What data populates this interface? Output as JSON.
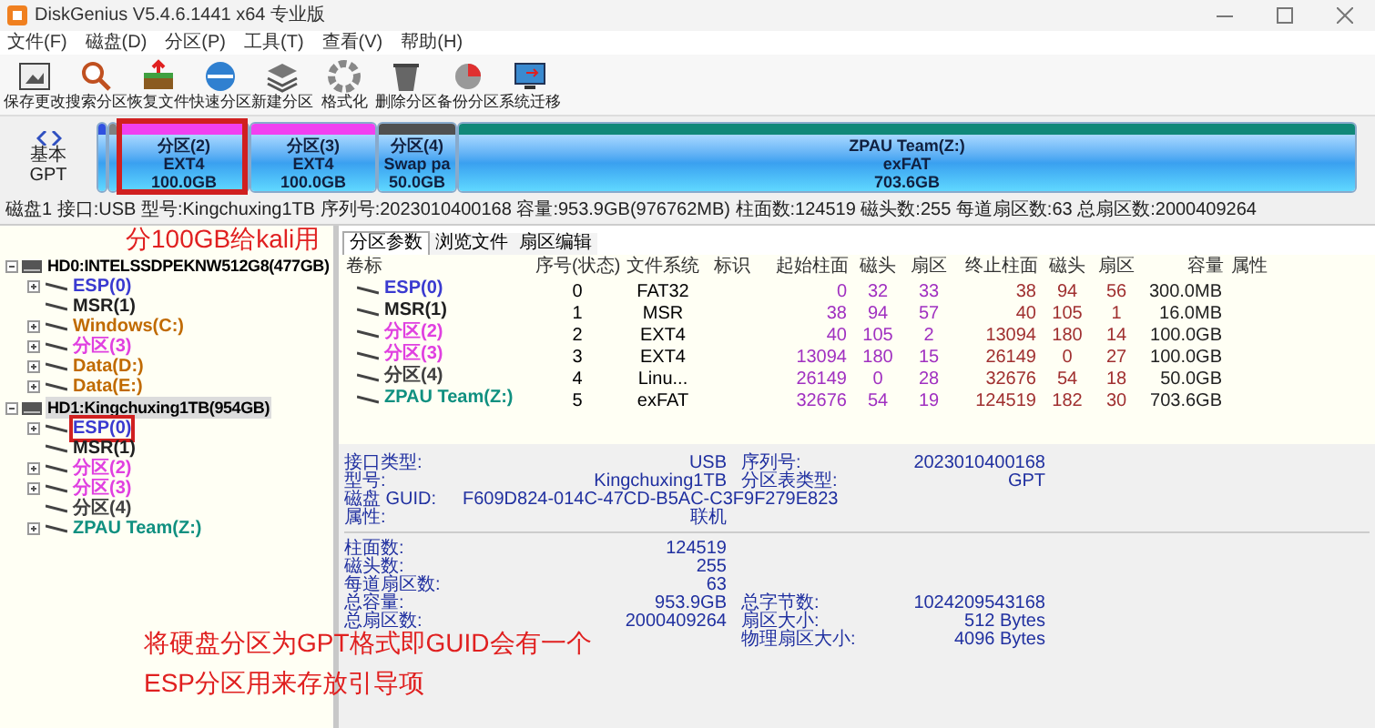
{
  "window": {
    "title": "DiskGenius V5.4.6.1441 x64 专业版"
  },
  "menu": [
    "文件(F)",
    "磁盘(D)",
    "分区(P)",
    "工具(T)",
    "查看(V)",
    "帮助(H)"
  ],
  "toolbar": [
    {
      "kind": "save",
      "label": "保存更改"
    },
    {
      "kind": "search",
      "label": "搜索分区"
    },
    {
      "kind": "recover",
      "label": "恢复文件"
    },
    {
      "kind": "quick",
      "label": "快速分区"
    },
    {
      "kind": "new",
      "label": "新建分区"
    },
    {
      "kind": "format",
      "label": "格式化"
    },
    {
      "kind": "delete",
      "label": "删除分区"
    },
    {
      "kind": "backup",
      "label": "备份分区"
    },
    {
      "kind": "migrate",
      "label": "系统迁移"
    }
  ],
  "disk_map": {
    "type_lines": [
      "基本",
      "GPT"
    ],
    "partitions": [
      {
        "color": "#3050e0"
      },
      {
        "color": "#808080"
      },
      {
        "lines": [
          "分区(2)",
          "EXT4",
          "100.0GB"
        ],
        "color": "#f040f0"
      },
      {
        "lines": [
          "分区(3)",
          "EXT4",
          "100.0GB"
        ],
        "color": "#f040f0"
      },
      {
        "lines": [
          "分区(4)",
          "Swap pa",
          "50.0GB"
        ],
        "color": "#505050"
      },
      {
        "lines": [
          "ZPAU Team(Z:)",
          "exFAT",
          "703.6GB"
        ],
        "color": "#108878"
      }
    ]
  },
  "disk_info_line": "磁盘1 接口:USB 型号:Kingchuxing1TB 序列号:2023010400168 容量:953.9GB(976762MB) 柱面数:124519 磁头数:255 每道扇区数:63 总扇区数:2000409264",
  "tree": [
    {
      "label": "HD0:INTELSSDPEKNW512G8(477GB)",
      "selected": false,
      "children": [
        {
          "label": "ESP(0)",
          "color": "#3a3ad0",
          "expander": true
        },
        {
          "label": "MSR(1)",
          "color": "#202020",
          "expander": false
        },
        {
          "label": "Windows(C:)",
          "color": "#c06a00",
          "expander": true
        },
        {
          "label": "分区(3)",
          "color": "#e040e0",
          "expander": true
        },
        {
          "label": "Data(D:)",
          "color": "#c06a00",
          "expander": true
        },
        {
          "label": "Data(E:)",
          "color": "#c06a00",
          "expander": true
        }
      ]
    },
    {
      "label": "HD1:Kingchuxing1TB(954GB)",
      "selected": true,
      "children": [
        {
          "label": "ESP(0)",
          "color": "#3a3ad0",
          "expander": true
        },
        {
          "label": "MSR(1)",
          "color": "#202020",
          "expander": false
        },
        {
          "label": "分区(2)",
          "color": "#e040e0",
          "expander": true
        },
        {
          "label": "分区(3)",
          "color": "#e040e0",
          "expander": true
        },
        {
          "label": "分区(4)",
          "color": "#404040",
          "expander": false
        },
        {
          "label": "ZPAU Team(Z:)",
          "color": "#109080",
          "expander": true
        }
      ]
    }
  ],
  "tabs": [
    {
      "label": "分区参数",
      "selected": true
    },
    {
      "label": "浏览文件",
      "selected": false
    },
    {
      "label": "扇区编辑",
      "selected": false
    }
  ],
  "table": {
    "columns": [
      "卷标",
      "序号(状态)",
      "文件系统",
      "标识",
      "起始柱面",
      "磁头",
      "扇区",
      "终止柱面",
      "磁头",
      "扇区",
      "容量",
      "属性"
    ],
    "rows": [
      {
        "color": "#3a3ad0",
        "cells": [
          "ESP(0)",
          "0",
          "FAT32",
          null,
          "0",
          "32",
          "33",
          "38",
          "94",
          "56",
          "300.0MB",
          null
        ]
      },
      {
        "color": "#202020",
        "cells": [
          "MSR(1)",
          "1",
          "MSR",
          null,
          "38",
          "94",
          "57",
          "40",
          "105",
          "1",
          "16.0MB",
          null
        ]
      },
      {
        "color": "#e040e0",
        "cells": [
          "分区(2)",
          "2",
          "EXT4",
          null,
          "40",
          "105",
          "2",
          "13094",
          "180",
          "14",
          "100.0GB",
          null
        ]
      },
      {
        "color": "#e040e0",
        "cells": [
          "分区(3)",
          "3",
          "EXT4",
          null,
          "13094",
          "180",
          "15",
          "26149",
          "0",
          "27",
          "100.0GB",
          null
        ]
      },
      {
        "color": "#404040",
        "cells": [
          "分区(4)",
          "4",
          "Linu...",
          null,
          "26149",
          "0",
          "28",
          "32676",
          "54",
          "18",
          "50.0GB",
          null
        ]
      },
      {
        "color": "#109080",
        "cells": [
          "ZPAU Team(Z:)",
          "5",
          "exFAT",
          null,
          "32676",
          "54",
          "19",
          "124519",
          "182",
          "30",
          "703.6GB",
          null
        ]
      }
    ]
  },
  "details": [
    [
      {
        "label": "接口类型:",
        "value": "USB",
        "label2": "序列号:",
        "value2": "2023010400168"
      },
      {
        "label": "型号:",
        "value": "Kingchuxing1TB",
        "label2": "分区表类型:",
        "value2": "GPT"
      },
      {
        "label": "磁盘 GUID:",
        "value": "F609D824-014C-47CD-B5AC-C3F9F279E823"
      },
      {
        "label": "属性:",
        "value": "联机"
      }
    ],
    [
      {
        "label": "柱面数:",
        "value": "124519"
      },
      {
        "label": "磁头数:",
        "value": "255"
      },
      {
        "label": "每道扇区数:",
        "value": "63"
      },
      {
        "label": "总容量:",
        "value": "953.9GB",
        "label2": "总字节数:",
        "value2": "1024209543168"
      },
      {
        "label": "总扇区数:",
        "value": "2000409264",
        "label2": "扇区大小:",
        "value2": "512 Bytes"
      },
      {
        "label2": "物理扇区大小:",
        "value2": "4096 Bytes"
      }
    ]
  ],
  "annotations": [
    {
      "kind": "disk-box",
      "lines": [
        "分100GB给kali用"
      ]
    },
    {
      "kind": "tree-box",
      "lines": [
        "将硬盘分区为GPT格式即GUID会有一个",
        "ESP分区用来存放引导项"
      ]
    }
  ]
}
